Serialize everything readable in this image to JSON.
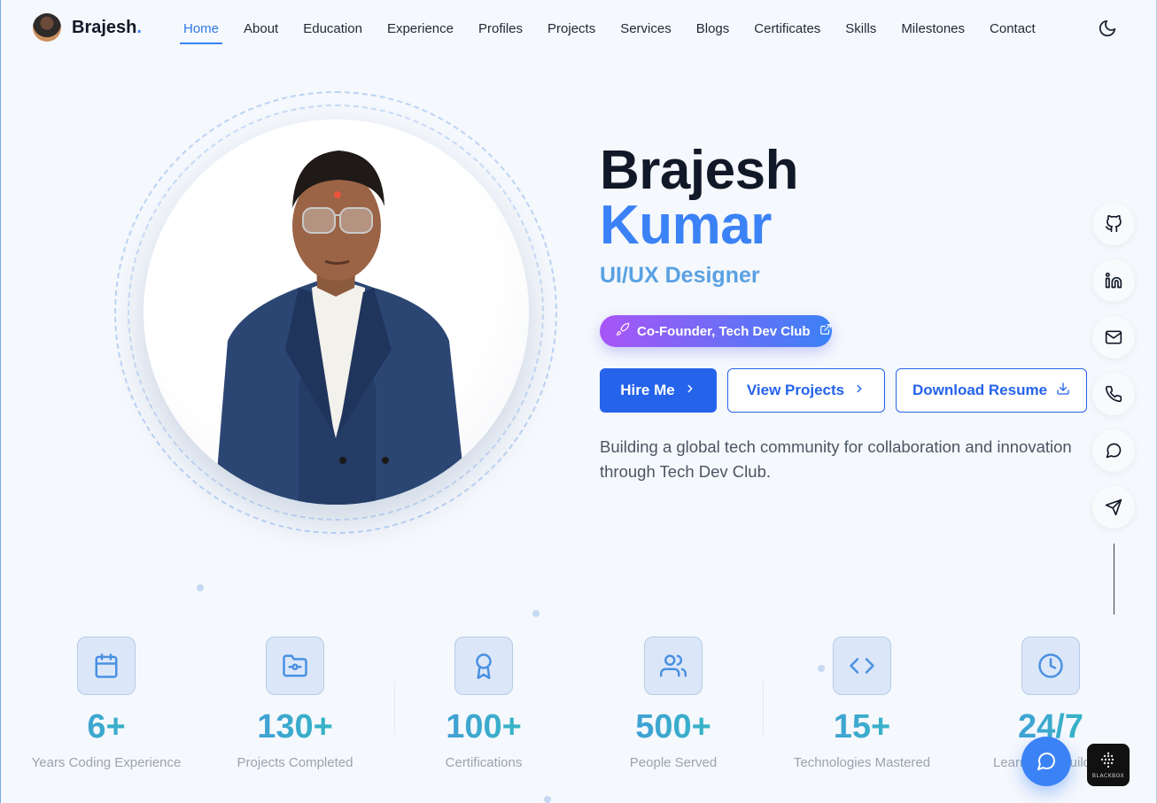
{
  "brand": {
    "name": "Brajesh",
    "dot": ".",
    "avatar_icon": "avatar"
  },
  "nav": {
    "items": [
      {
        "label": "Home",
        "active": true
      },
      {
        "label": "About"
      },
      {
        "label": "Education"
      },
      {
        "label": "Experience"
      },
      {
        "label": "Profiles"
      },
      {
        "label": "Projects"
      },
      {
        "label": "Services"
      },
      {
        "label": "Blogs"
      },
      {
        "label": "Certificates"
      },
      {
        "label": "Skills"
      },
      {
        "label": "Milestones"
      },
      {
        "label": "Contact"
      }
    ],
    "theme_toggle_icon": "moon-icon"
  },
  "hero": {
    "first_name": "Brajesh",
    "last_name": "Kumar",
    "role": "UI/UX Designer",
    "badge": {
      "label": "Co-Founder, Tech Dev Club",
      "icon": "rocket-icon",
      "trailing_icon": "external-link-icon"
    },
    "buttons": {
      "hire": "Hire Me",
      "projects": "View Projects",
      "resume": "Download Resume"
    },
    "intro": "Building a global tech community for collaboration and innovation through Tech Dev Club."
  },
  "social": [
    "github-icon",
    "linkedin-icon",
    "mail-icon",
    "phone-icon",
    "message-icon",
    "send-icon"
  ],
  "stats": [
    {
      "value": "6+",
      "label": "Years Coding Experience",
      "icon": "calendar-icon"
    },
    {
      "value": "130+",
      "label": "Projects Completed",
      "icon": "folder-icon"
    },
    {
      "value": "100+",
      "label": "Certifications",
      "icon": "award-icon"
    },
    {
      "value": "500+",
      "label": "People Served",
      "icon": "users-icon"
    },
    {
      "value": "15+",
      "label": "Technologies Mastered",
      "icon": "code-icon"
    },
    {
      "value": "24/7",
      "label": "Learning & Building",
      "icon": "clock-icon"
    }
  ],
  "floating": {
    "chat_icon": "chat-icon",
    "blackbox_label": "BLACKBOX"
  },
  "colors": {
    "accent": "#3b82f6",
    "primary_button": "#2563eb",
    "role": "#5aa1e3",
    "badge_from": "#a855f7",
    "badge_to": "#3b82f6"
  }
}
